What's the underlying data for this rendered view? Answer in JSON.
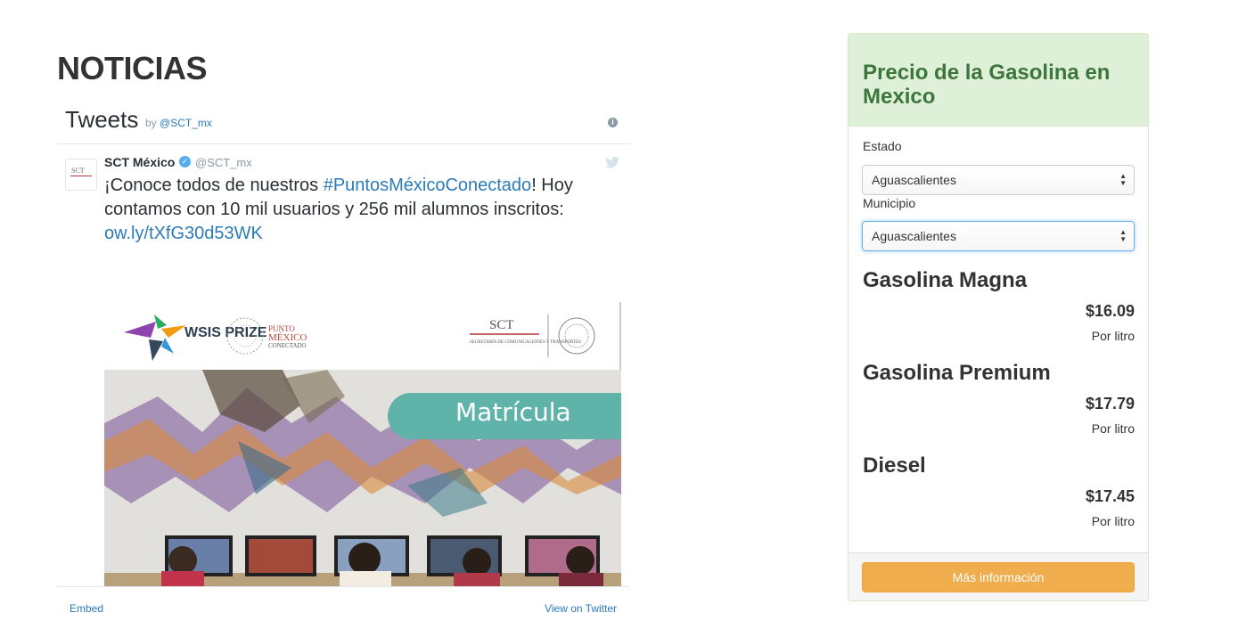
{
  "news": {
    "title": "NOTICIAS"
  },
  "tweets_widget": {
    "title": "Tweets",
    "by_prefix": "by",
    "by_handle": "@SCT_mx",
    "tweet": {
      "author_name": "SCT México",
      "author_handle": "@SCT_mx",
      "text_before": "¡Conoce todos de nuestros ",
      "hashtag": "#PuntosMéxicoConectado",
      "text_after": "! Hoy contamos con 10 mil usuarios y 256 mil alumnos inscritos: ",
      "link": "ow.ly/tXfG30d53WK",
      "media": {
        "banner_logo_left": "WSIS PRIZE",
        "banner_logo_mid_1": "PUNTO",
        "banner_logo_mid_2": "MÉXICO",
        "banner_logo_mid_3": "CONECTADO",
        "banner_logo_right": "SCT",
        "banner_logo_right_sub": "SECRETARÍA DE COMUNICACIONES Y TRANSPORTES",
        "overlay_label": "Matrícula"
      }
    },
    "footer": {
      "embed": "Embed",
      "view_on_twitter": "View on Twitter"
    }
  },
  "gas_panel": {
    "title": "Precio de la Gasolina en Mexico",
    "estado_label": "Estado",
    "estado_value": "Aguascalientes",
    "municipio_label": "Municipio",
    "municipio_value": "Aguascalientes",
    "fuels": [
      {
        "name": "Gasolina Magna",
        "price": "$16.09",
        "unit": "Por litro"
      },
      {
        "name": "Gasolina Premium",
        "price": "$17.79",
        "unit": "Por litro"
      },
      {
        "name": "Diesel",
        "price": "$17.45",
        "unit": "Por litro"
      }
    ],
    "more_button": "Más información",
    "colors": {
      "heading_bg": "#dff0d8",
      "heading_text": "#3c763d",
      "button_bg": "#f0ad4e"
    }
  }
}
